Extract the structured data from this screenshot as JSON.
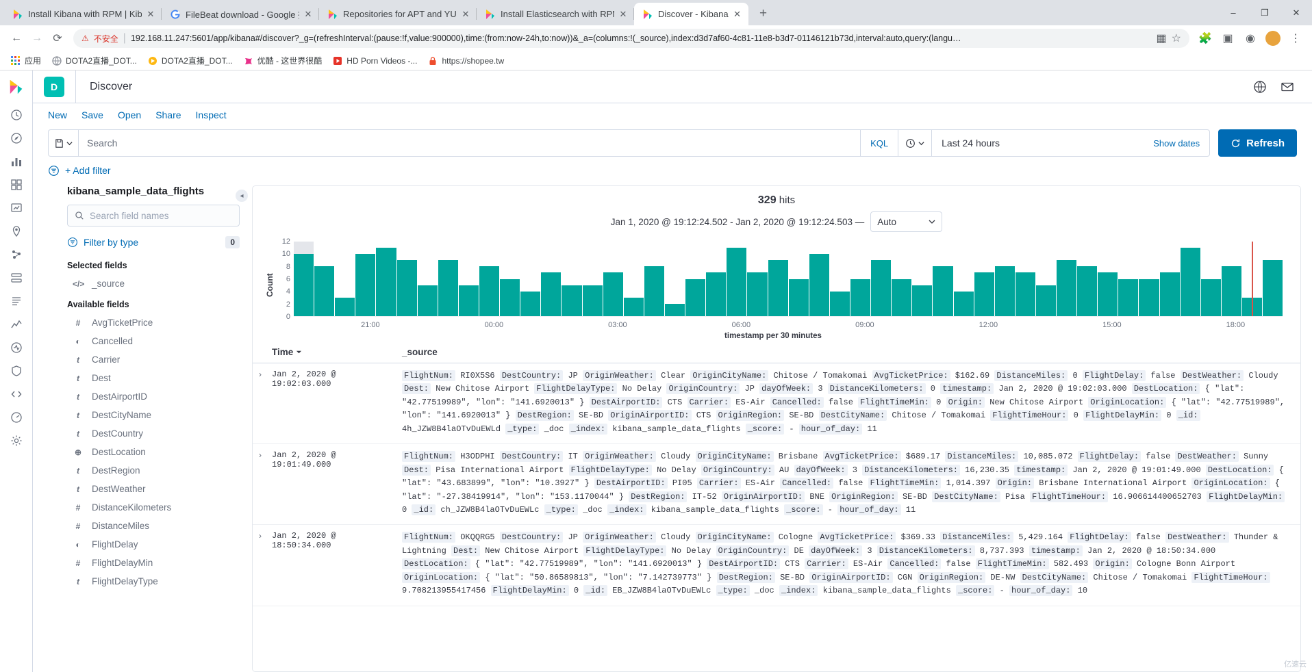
{
  "browser": {
    "tabs": [
      {
        "title": "Install Kibana with RPM | Kiba",
        "favicon": "kibana-icon",
        "active": false
      },
      {
        "title": "FileBeat download - Google 搜",
        "favicon": "google-icon",
        "active": false
      },
      {
        "title": "Repositories for APT and YUM",
        "favicon": "kibana-icon",
        "active": false
      },
      {
        "title": "Install Elasticsearch with RPM",
        "favicon": "kibana-icon",
        "active": false
      },
      {
        "title": "Discover - Kibana",
        "favicon": "kibana-icon",
        "active": true
      }
    ],
    "new_tab_label": "+",
    "window_controls": {
      "minimize": "–",
      "maximize": "❐",
      "close": "✕"
    },
    "nav": {
      "back": "←",
      "forward": "→",
      "reload": "⟳",
      "security_warning": "不安全",
      "url": "192.168.11.247:5601/app/kibana#/discover?_g=(refreshInterval:(pause:!f,value:900000),time:(from:now-24h,to:now))&_a=(columns:!(_source),index:d3d7af60-4c81-11e8-b3d7-01146121b73d,interval:auto,query:(langu…",
      "url_host": "192.168.11.247",
      "url_port": ":5601"
    },
    "bookmarks": [
      {
        "label": "应用",
        "icon": "apps-grid-icon"
      },
      {
        "label": "DOTA2直播_DOT...",
        "icon": "site-icon"
      },
      {
        "label": "DOTA2直播_DOT...",
        "icon": "site-icon"
      },
      {
        "label": "优酷 - 这世界很酷",
        "icon": "youku-icon"
      },
      {
        "label": "HD Porn Videos -...",
        "icon": "video-icon"
      },
      {
        "label": "https://shopee.tw",
        "icon": "lock-icon"
      }
    ]
  },
  "kibana": {
    "left_nav": {
      "logo": "elastic-logo",
      "items": [
        {
          "name": "recently-viewed",
          "icon": "clock-icon"
        },
        {
          "name": "discover",
          "icon": "discover-icon"
        },
        {
          "name": "visualize",
          "icon": "visualize-icon"
        },
        {
          "name": "dashboard",
          "icon": "dashboard-icon"
        },
        {
          "name": "canvas",
          "icon": "canvas-icon"
        },
        {
          "name": "maps",
          "icon": "maps-icon"
        },
        {
          "name": "machine-learning",
          "icon": "ml-icon"
        },
        {
          "name": "infrastructure",
          "icon": "infra-icon"
        },
        {
          "name": "logs",
          "icon": "logs-icon"
        },
        {
          "name": "apm",
          "icon": "apm-icon"
        },
        {
          "name": "uptime",
          "icon": "uptime-icon"
        },
        {
          "name": "siem",
          "icon": "siem-icon"
        },
        {
          "name": "dev-tools",
          "icon": "wrench-icon"
        },
        {
          "name": "monitoring",
          "icon": "monitor-icon"
        },
        {
          "name": "management",
          "icon": "gear-icon"
        }
      ]
    },
    "header": {
      "badge": "D",
      "app_title": "Discover",
      "right_icons": [
        "globe-icon",
        "mail-icon"
      ]
    },
    "toolbar": [
      "New",
      "Save",
      "Open",
      "Share",
      "Inspect"
    ],
    "query": {
      "datasource_icon": "save-query-icon",
      "placeholder": "Search",
      "value": "",
      "language": "KQL",
      "time_range": "Last 24 hours",
      "show_dates": "Show dates",
      "refresh_label": "Refresh"
    },
    "filters": {
      "add_filter": "+ Add filter"
    },
    "sidebar": {
      "index_pattern": "kibana_sample_data_flights",
      "search_placeholder": "Search field names",
      "filter_by_type": "Filter by type",
      "filter_count": "0",
      "selected_fields_label": "Selected fields",
      "selected_fields": [
        {
          "name": "_source",
          "type": "source"
        }
      ],
      "available_fields_label": "Available fields",
      "available_fields": [
        {
          "name": "AvgTicketPrice",
          "type": "number"
        },
        {
          "name": "Cancelled",
          "type": "boolean"
        },
        {
          "name": "Carrier",
          "type": "string"
        },
        {
          "name": "Dest",
          "type": "string"
        },
        {
          "name": "DestAirportID",
          "type": "string"
        },
        {
          "name": "DestCityName",
          "type": "string"
        },
        {
          "name": "DestCountry",
          "type": "string"
        },
        {
          "name": "DestLocation",
          "type": "geo"
        },
        {
          "name": "DestRegion",
          "type": "string"
        },
        {
          "name": "DestWeather",
          "type": "string"
        },
        {
          "name": "DistanceKilometers",
          "type": "number"
        },
        {
          "name": "DistanceMiles",
          "type": "number"
        },
        {
          "name": "FlightDelay",
          "type": "boolean"
        },
        {
          "name": "FlightDelayMin",
          "type": "number"
        },
        {
          "name": "FlightDelayType",
          "type": "string"
        }
      ]
    },
    "results": {
      "hits_count": "329",
      "hits_label": "hits",
      "range_text": "Jan 1, 2020 @ 19:12:24.502 - Jan 2, 2020 @ 19:12:24.503 —",
      "interval": "Auto"
    },
    "table": {
      "col_time": "Time",
      "col_source": "_source",
      "sort_icon": "sort-desc-icon",
      "rows": [
        {
          "time": "Jan 2, 2020 @ 19:02:03.000",
          "fields": [
            [
              "FlightNum:",
              "RI0X5S6"
            ],
            [
              "DestCountry:",
              "JP"
            ],
            [
              "OriginWeather:",
              "Clear"
            ],
            [
              "OriginCityName:",
              "Chitose / Tomakomai"
            ],
            [
              "AvgTicketPrice:",
              "$162.69"
            ],
            [
              "DistanceMiles:",
              "0"
            ],
            [
              "FlightDelay:",
              "false"
            ],
            [
              "DestWeather:",
              "Cloudy"
            ],
            [
              "Dest:",
              "New Chitose Airport"
            ],
            [
              "FlightDelayType:",
              "No Delay"
            ],
            [
              "OriginCountry:",
              "JP"
            ],
            [
              "dayOfWeek:",
              "3"
            ],
            [
              "DistanceKilometers:",
              "0"
            ],
            [
              "timestamp:",
              "Jan 2, 2020 @ 19:02:03.000"
            ],
            [
              "DestLocation:",
              "{ \"lat\": \"42.77519989\", \"lon\": \"141.6920013\" }"
            ],
            [
              "DestAirportID:",
              "CTS"
            ],
            [
              "Carrier:",
              "ES-Air"
            ],
            [
              "Cancelled:",
              "false"
            ],
            [
              "FlightTimeMin:",
              "0"
            ],
            [
              "Origin:",
              "New Chitose Airport"
            ],
            [
              "OriginLocation:",
              "{ \"lat\": \"42.77519989\", \"lon\": \"141.6920013\" }"
            ],
            [
              "DestRegion:",
              "SE-BD"
            ],
            [
              "OriginAirportID:",
              "CTS"
            ],
            [
              "OriginRegion:",
              "SE-BD"
            ],
            [
              "DestCityName:",
              "Chitose / Tomakomai"
            ],
            [
              "FlightTimeHour:",
              "0"
            ],
            [
              "FlightDelayMin:",
              "0"
            ],
            [
              "_id:",
              "4h_JZW8B4laOTvDuEWLd"
            ],
            [
              "_type:",
              "_doc"
            ],
            [
              "_index:",
              "kibana_sample_data_flights"
            ],
            [
              "_score:",
              "-"
            ],
            [
              "hour_of_day:",
              "11"
            ]
          ]
        },
        {
          "time": "Jan 2, 2020 @ 19:01:49.000",
          "fields": [
            [
              "FlightNum:",
              "H3ODPHI"
            ],
            [
              "DestCountry:",
              "IT"
            ],
            [
              "OriginWeather:",
              "Cloudy"
            ],
            [
              "OriginCityName:",
              "Brisbane"
            ],
            [
              "AvgTicketPrice:",
              "$689.17"
            ],
            [
              "DistanceMiles:",
              "10,085.072"
            ],
            [
              "FlightDelay:",
              "false"
            ],
            [
              "DestWeather:",
              "Sunny"
            ],
            [
              "Dest:",
              "Pisa International Airport"
            ],
            [
              "FlightDelayType:",
              "No Delay"
            ],
            [
              "OriginCountry:",
              "AU"
            ],
            [
              "dayOfWeek:",
              "3"
            ],
            [
              "DistanceKilometers:",
              "16,230.35"
            ],
            [
              "timestamp:",
              "Jan 2, 2020 @ 19:01:49.000"
            ],
            [
              "DestLocation:",
              "{ \"lat\": \"43.683899\", \"lon\": \"10.3927\" }"
            ],
            [
              "DestAirportID:",
              "PI05"
            ],
            [
              "Carrier:",
              "ES-Air"
            ],
            [
              "Cancelled:",
              "false"
            ],
            [
              "FlightTimeMin:",
              "1,014.397"
            ],
            [
              "Origin:",
              "Brisbane International Airport"
            ],
            [
              "OriginLocation:",
              "{ \"lat\": \"-27.38419914\", \"lon\": \"153.1170044\" }"
            ],
            [
              "DestRegion:",
              "IT-52"
            ],
            [
              "OriginAirportID:",
              "BNE"
            ],
            [
              "OriginRegion:",
              "SE-BD"
            ],
            [
              "DestCityName:",
              "Pisa"
            ],
            [
              "FlightTimeHour:",
              "16.906614400652703"
            ],
            [
              "FlightDelayMin:",
              "0"
            ],
            [
              "_id:",
              "ch_JZW8B4laOTvDuEWLc"
            ],
            [
              "_type:",
              "_doc"
            ],
            [
              "_index:",
              "kibana_sample_data_flights"
            ],
            [
              "_score:",
              "-"
            ],
            [
              "hour_of_day:",
              "11"
            ]
          ]
        },
        {
          "time": "Jan 2, 2020 @ 18:50:34.000",
          "fields": [
            [
              "FlightNum:",
              "OKQQRG5"
            ],
            [
              "DestCountry:",
              "JP"
            ],
            [
              "OriginWeather:",
              "Cloudy"
            ],
            [
              "OriginCityName:",
              "Cologne"
            ],
            [
              "AvgTicketPrice:",
              "$369.33"
            ],
            [
              "DistanceMiles:",
              "5,429.164"
            ],
            [
              "FlightDelay:",
              "false"
            ],
            [
              "DestWeather:",
              "Thunder & Lightning"
            ],
            [
              "Dest:",
              "New Chitose Airport"
            ],
            [
              "FlightDelayType:",
              "No Delay"
            ],
            [
              "OriginCountry:",
              "DE"
            ],
            [
              "dayOfWeek:",
              "3"
            ],
            [
              "DistanceKilometers:",
              "8,737.393"
            ],
            [
              "timestamp:",
              "Jan 2, 2020 @ 18:50:34.000"
            ],
            [
              "DestLocation:",
              "{ \"lat\": \"42.77519989\", \"lon\": \"141.6920013\" }"
            ],
            [
              "DestAirportID:",
              "CTS"
            ],
            [
              "Carrier:",
              "ES-Air"
            ],
            [
              "Cancelled:",
              "false"
            ],
            [
              "FlightTimeMin:",
              "582.493"
            ],
            [
              "Origin:",
              "Cologne Bonn Airport"
            ],
            [
              "OriginLocation:",
              "{ \"lat\": \"50.86589813\", \"lon\": \"7.142739773\" }"
            ],
            [
              "DestRegion:",
              "SE-BD"
            ],
            [
              "OriginAirportID:",
              "CGN"
            ],
            [
              "OriginRegion:",
              "DE-NW"
            ],
            [
              "DestCityName:",
              "Chitose / Tomakomai"
            ],
            [
              "FlightTimeHour:",
              "9.708213955417456"
            ],
            [
              "FlightDelayMin:",
              "0"
            ],
            [
              "_id:",
              "EB_JZW8B4laOTvDuEWLc"
            ],
            [
              "_type:",
              "_doc"
            ],
            [
              "_index:",
              "kibana_sample_data_flights"
            ],
            [
              "_score:",
              "-"
            ],
            [
              "hour_of_day:",
              "10"
            ]
          ]
        }
      ]
    },
    "watermark": "亿速云"
  },
  "chart_data": {
    "type": "bar",
    "title": "",
    "xlabel": "timestamp per 30 minutes",
    "ylabel": "Count",
    "ylim": [
      0,
      12
    ],
    "yticks": [
      0,
      2,
      4,
      6,
      8,
      10,
      12
    ],
    "xticks": [
      "21:00",
      "00:00",
      "03:00",
      "06:00",
      "09:00",
      "12:00",
      "15:00",
      "18:00"
    ],
    "grid": false,
    "bar_color": "#00a69b",
    "ghost_color": "#e4e6eb",
    "marker_color": "#d9544a",
    "categories": [
      "19:30",
      "20:00",
      "20:30",
      "21:00",
      "21:30",
      "22:00",
      "22:30",
      "23:00",
      "23:30",
      "00:00",
      "00:30",
      "01:00",
      "01:30",
      "02:00",
      "02:30",
      "03:00",
      "03:30",
      "04:00",
      "04:30",
      "05:00",
      "05:30",
      "06:00",
      "06:30",
      "07:00",
      "07:30",
      "08:00",
      "08:30",
      "09:00",
      "09:30",
      "10:00",
      "10:30",
      "11:00",
      "11:30",
      "12:00",
      "12:30",
      "13:00",
      "13:30",
      "14:00",
      "14:30",
      "15:00",
      "15:30",
      "16:00",
      "16:30",
      "17:00",
      "17:30",
      "18:00",
      "18:30",
      "19:00"
    ],
    "values": [
      10,
      8,
      3,
      10,
      11,
      9,
      5,
      9,
      5,
      8,
      6,
      4,
      7,
      5,
      5,
      7,
      3,
      8,
      2,
      6,
      7,
      11,
      7,
      9,
      6,
      10,
      4,
      6,
      9,
      6,
      5,
      8,
      4,
      7,
      8,
      7,
      5,
      9,
      8,
      7,
      6,
      6,
      7,
      11,
      6,
      8,
      3,
      9
    ],
    "ghost_bars": [
      {
        "index": 0,
        "value": 12
      }
    ],
    "marker_at_index": 46
  }
}
